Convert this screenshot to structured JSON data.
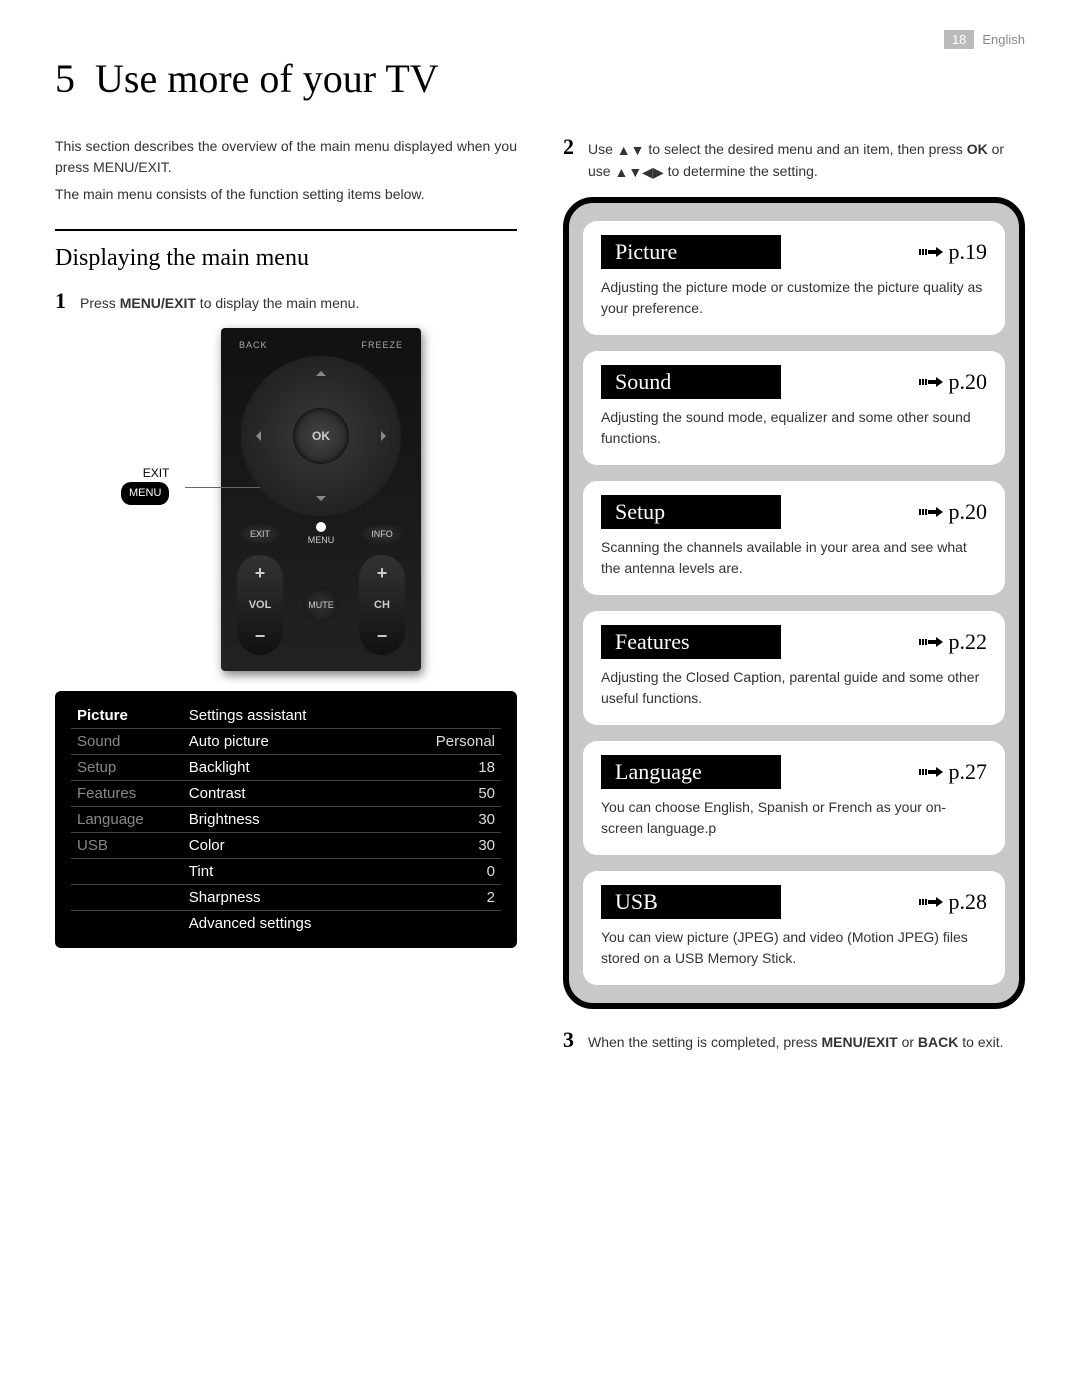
{
  "header": {
    "page_number": "18",
    "language": "English"
  },
  "chapter": {
    "number": "5",
    "title": "Use more of your TV"
  },
  "intro": {
    "line1": "This section describes the overview of the main menu displayed when you press MENU/EXIT.",
    "line2": "The main menu consists of the function setting items below."
  },
  "section_heading": "Displaying the main menu",
  "step1": {
    "n": "1",
    "prefix": "Press ",
    "kw": "MENU/EXIT",
    "suffix": " to display the main menu."
  },
  "step2": {
    "n": "2",
    "text_a": "Use ",
    "arrows_a": "▲▼",
    "text_b": " to select the desired menu and an item, then press ",
    "kw_ok": "OK",
    "text_c": " or use ",
    "arrows_b": "▲▼◀▶",
    "text_d": " to determine the setting."
  },
  "step3": {
    "n": "3",
    "text_a": "When the setting is completed, press ",
    "kw1": "MENU/EXIT",
    "text_b": " or ",
    "kw2": "BACK",
    "text_c": " to exit."
  },
  "remote": {
    "back": "BACK",
    "freeze": "FREEZE",
    "ok": "OK",
    "exit": "EXIT",
    "menu": "MENU",
    "info": "INFO",
    "vol": "VOL",
    "mute": "MUTE",
    "ch": "CH",
    "callout_top": "EXIT",
    "callout_bubble": "MENU"
  },
  "osd": {
    "menus": [
      "Picture",
      "Sound",
      "Setup",
      "Features",
      "Language",
      "USB"
    ],
    "rows": [
      {
        "label": "Settings assistant",
        "value": ""
      },
      {
        "label": "Auto picture",
        "value": "Personal"
      },
      {
        "label": "Backlight",
        "value": "18"
      },
      {
        "label": "Contrast",
        "value": "50"
      },
      {
        "label": "Brightness",
        "value": "30"
      },
      {
        "label": "Color",
        "value": "30"
      },
      {
        "label": "Tint",
        "value": "0"
      },
      {
        "label": "Sharpness",
        "value": "2"
      },
      {
        "label": "Advanced settings",
        "value": ""
      }
    ]
  },
  "cards": [
    {
      "title": "Picture",
      "page": "p.19",
      "desc": "Adjusting the picture mode or customize the picture quality as your preference."
    },
    {
      "title": "Sound",
      "page": "p.20",
      "desc": "Adjusting the sound mode, equalizer and some other sound functions."
    },
    {
      "title": "Setup",
      "page": "p.20",
      "desc": "Scanning the channels available in your area and see what the antenna levels are."
    },
    {
      "title": "Features",
      "page": "p.22",
      "desc": "Adjusting the Closed Caption, parental guide and some other useful functions."
    },
    {
      "title": "Language",
      "page": "p.27",
      "desc": "You can choose English, Spanish or French as your on-screen language.p"
    },
    {
      "title": "USB",
      "page": "p.28",
      "desc": "You can view picture (JPEG) and video (Motion JPEG) files stored on a USB Memory Stick."
    }
  ]
}
